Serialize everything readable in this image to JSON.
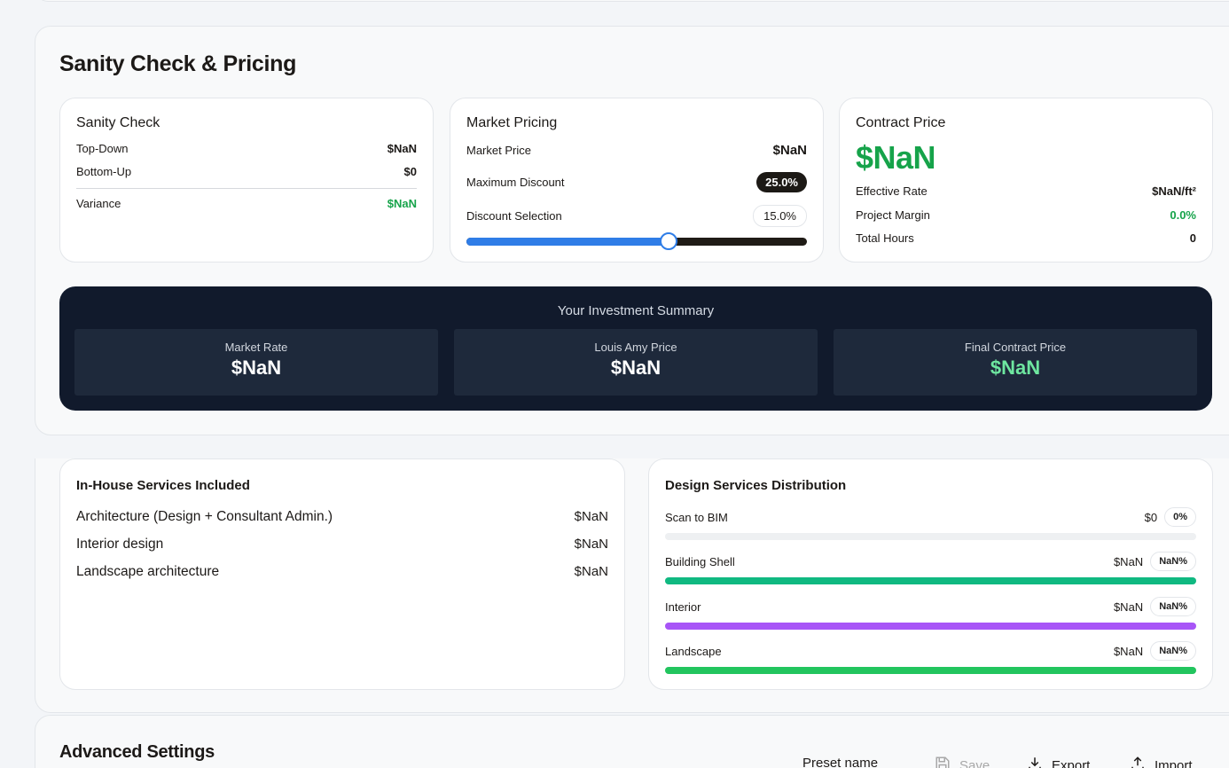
{
  "pricing_section": {
    "title": "Sanity Check & Pricing",
    "sanity": {
      "title": "Sanity Check",
      "top_down_label": "Top-Down",
      "top_down_value": "$NaN",
      "bottom_up_label": "Bottom-Up",
      "bottom_up_value": "$0",
      "variance_label": "Variance",
      "variance_value": "$NaN"
    },
    "market": {
      "title": "Market Pricing",
      "market_price_label": "Market Price",
      "market_price_value": "$NaN",
      "max_discount_label": "Maximum Discount",
      "max_discount_value": "25.0%",
      "discount_selection_label": "Discount Selection",
      "discount_selection_value": "15.0%",
      "slider_fraction": 0.593
    },
    "contract": {
      "title": "Contract Price",
      "price": "$NaN",
      "effective_rate_label": "Effective Rate",
      "effective_rate_value": "$NaN/ft²",
      "project_margin_label": "Project Margin",
      "project_margin_value": "0.0%",
      "total_hours_label": "Total Hours",
      "total_hours_value": "0"
    },
    "summary": {
      "title": "Your Investment Summary",
      "boxes": [
        {
          "label": "Market Rate",
          "value": "$NaN"
        },
        {
          "label": "Louis Amy Price",
          "value": "$NaN"
        },
        {
          "label": "Final Contract Price",
          "value": "$NaN"
        }
      ]
    }
  },
  "services": {
    "title": "In-House Services Included",
    "items": [
      {
        "label": "Architecture (Design + Consultant Admin.)",
        "value": "$NaN"
      },
      {
        "label": "Interior design",
        "value": "$NaN"
      },
      {
        "label": "Landscape architecture",
        "value": "$NaN"
      }
    ]
  },
  "distribution": {
    "title": "Design Services Distribution",
    "items": [
      {
        "label": "Scan to BIM",
        "value": "$0",
        "pct": "0%",
        "color": "#e5e7eb",
        "fill": 0
      },
      {
        "label": "Building Shell",
        "value": "$NaN",
        "pct": "NaN%",
        "color": "#10b981",
        "fill": 1
      },
      {
        "label": "Interior",
        "value": "$NaN",
        "pct": "NaN%",
        "color": "#a855f7",
        "fill": 1
      },
      {
        "label": "Landscape",
        "value": "$NaN",
        "pct": "NaN%",
        "color": "#22c55e",
        "fill": 1
      }
    ]
  },
  "advanced": {
    "title": "Advanced Settings",
    "preset_label": "Preset name",
    "save_label": "Save",
    "export_label": "Export",
    "import_label": "Import"
  }
}
